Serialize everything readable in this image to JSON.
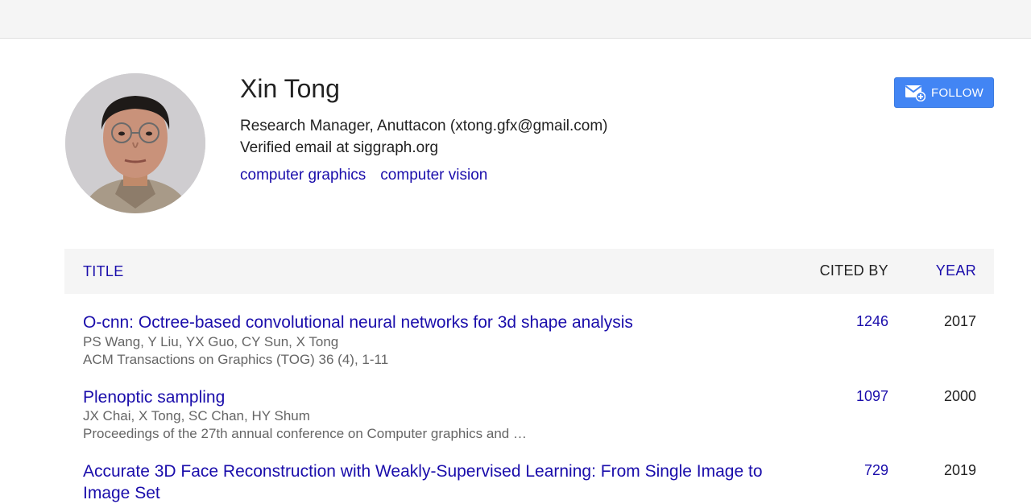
{
  "profile": {
    "name": "Xin Tong",
    "affiliation": "Research Manager, Anuttacon (xtong.gfx@gmail.com)",
    "verified": "Verified email at siggraph.org",
    "interests": [
      "computer graphics",
      "computer vision"
    ],
    "avatar_icon": "person-photo"
  },
  "follow": {
    "label": "FOLLOW",
    "icon": "email-plus-icon",
    "color": "#4285f4"
  },
  "table": {
    "headers": {
      "title": "TITLE",
      "cited_by": "CITED BY",
      "year": "YEAR"
    },
    "rows": [
      {
        "title": "O-cnn: Octree-based convolutional neural networks for 3d shape analysis",
        "authors": "PS Wang, Y Liu, YX Guo, CY Sun, X Tong",
        "venue": "ACM Transactions on Graphics (TOG) 36 (4), 1-11",
        "cited_by": "1246",
        "year": "2017"
      },
      {
        "title": "Plenoptic sampling",
        "authors": "JX Chai, X Tong, SC Chan, HY Shum",
        "venue": "Proceedings of the 27th annual conference on Computer graphics and …",
        "cited_by": "1097",
        "year": "2000"
      },
      {
        "title": "Accurate 3D Face Reconstruction with Weakly-Supervised Learning: From Single Image to Image Set",
        "authors": "",
        "venue": "",
        "cited_by": "729",
        "year": "2019"
      }
    ]
  },
  "colors": {
    "link": "#1a0dab",
    "header_bg": "#f5f5f5",
    "muted": "#666666"
  }
}
